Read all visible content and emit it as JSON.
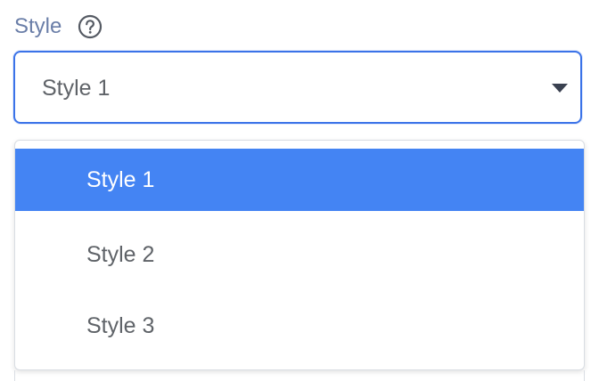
{
  "field": {
    "label": "Style",
    "help_icon": "question-circle-icon"
  },
  "select": {
    "value": "Style 1",
    "caret_icon": "caret-down-icon"
  },
  "menu": {
    "items": [
      {
        "label": "Style 1",
        "selected": true
      },
      {
        "label": "Style 2",
        "selected": false
      },
      {
        "label": "Style 3",
        "selected": false
      }
    ]
  },
  "colors": {
    "accent": "#3b73e8",
    "selected_bg": "#4484f3",
    "label": "#6a7ea8"
  }
}
